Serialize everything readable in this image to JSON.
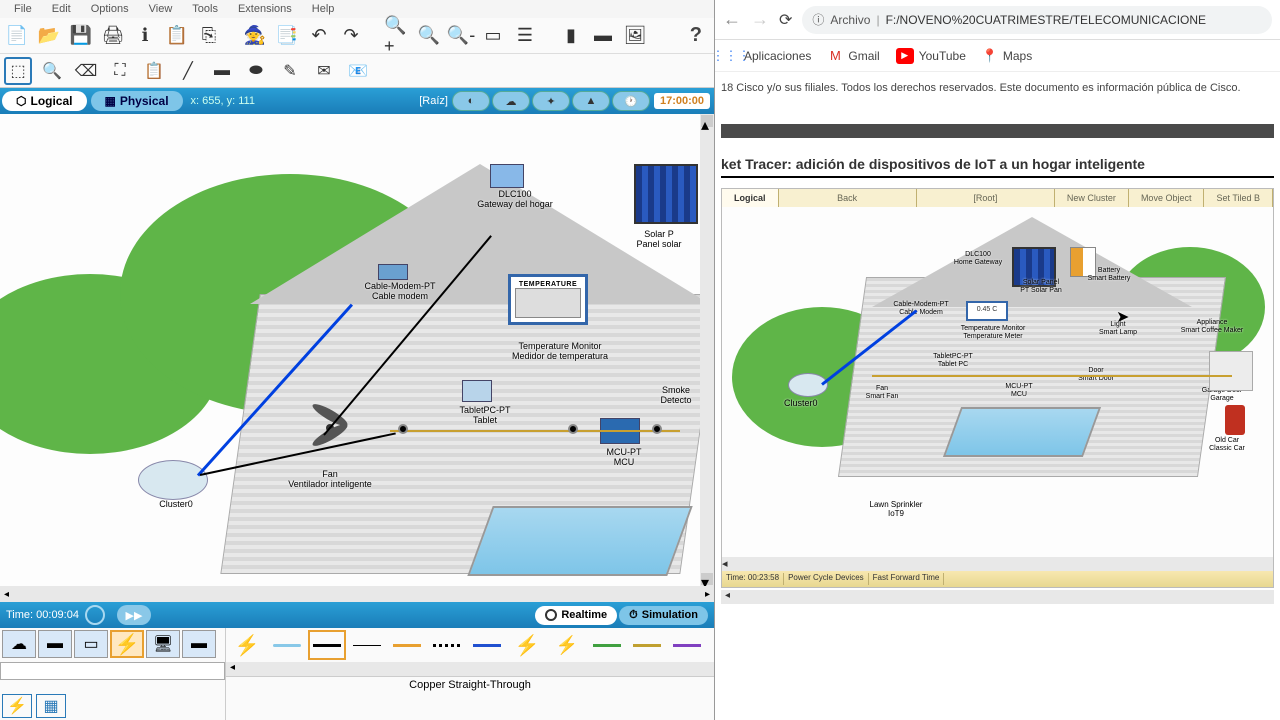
{
  "menu": {
    "file": "File",
    "edit": "Edit",
    "options": "Options",
    "view": "View",
    "tools": "Tools",
    "extensions": "Extensions",
    "help": "Help"
  },
  "view_tabs": {
    "logical": "Logical",
    "physical": "Physical"
  },
  "coords": "x: 655, y: 111",
  "raiz": "[Raíz]",
  "top_time": "17:00:00",
  "devices": {
    "dlc": "DLC100",
    "gateway": "Gateway del hogar",
    "solar1": "Solar P",
    "solar2": "Panel solar",
    "modem1": "Cable-Modem-PT",
    "modem2": "Cable modem",
    "temp_title": "TEMPERATURE",
    "temp1": "Temperature Monitor",
    "temp2": "Medidor de temperatura",
    "tablet1": "TabletPC-PT",
    "tablet2": "Tablet",
    "smoke1": "Smoke",
    "smoke2": "Detecto",
    "mcu1": "MCU-PT",
    "mcu2": "MCU",
    "fan1": "Fan",
    "fan2": "Ventilador inteligente",
    "cluster": "Cluster0"
  },
  "bottom_time": "Time: 00:09:04",
  "modes": {
    "realtime": "Realtime",
    "simulation": "Simulation"
  },
  "selected_connection": "Copper Straight-Through",
  "browser": {
    "archivo": "Archivo",
    "url": "F:/NOVENO%20CUATRIMESTRE/TELECOMUNICACIONE",
    "apps": "Aplicaciones",
    "gmail": "Gmail",
    "youtube": "YouTube",
    "maps": "Maps"
  },
  "doc": {
    "copyright": "18 Cisco y/o sus filiales. Todos los derechos reservados. Este documento es información pública de Cisco.",
    "title": "ket Tracer: adición de dispositivos de IoT a un hogar inteligente",
    "tabs": {
      "logical": "Logical",
      "back": "Back",
      "root": "[Root]",
      "new_cluster": "New Cluster",
      "move_obj": "Move Object",
      "tiled": "Set Tiled B"
    },
    "labels": {
      "modem": "Cable-Modem-PT\nCable Modem",
      "gateway": "DLC100\nHome Gateway",
      "solar": "Solar Panel\nPT Solar Pan",
      "battery": "Battery\nSmart Battery",
      "temp_val": "0.45 C",
      "temp": "Temperature Monitor\nTemperature Meter",
      "tablet": "TabletPC-PT\nTablet PC",
      "fan": "Fan\nSmart Fan",
      "mcu": "MCU-PT\nMCU",
      "light": "Light\nSmart Lamp",
      "door": "Door\nSmart Door",
      "coffee": "Appliance\nSmart Coffee Maker",
      "garage": "Garage Door\nGarage",
      "car": "Old Car\nClassic Car",
      "sprinkler": "Lawn Sprinkler\nIoT9",
      "cluster": "Cluster0"
    },
    "timebar": {
      "time": "Time: 00:23:58",
      "power": "Power Cycle Devices",
      "ff": "Fast Forward Time"
    }
  }
}
